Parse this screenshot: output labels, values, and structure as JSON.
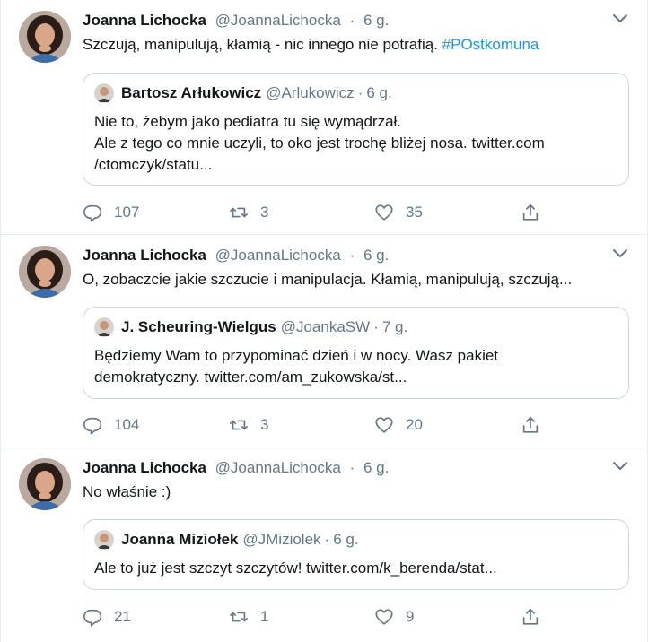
{
  "colors": {
    "text": "#14171a",
    "secondary": "#657786",
    "link": "#1b95e0",
    "border": "#ccd6dd",
    "divider": "#e6ecf0"
  },
  "tweets": [
    {
      "author": {
        "name": "Joanna Lichocka",
        "handle": "@JoannaLichocka",
        "time": "6 g."
      },
      "text": "Szczują, manipulują, kłamią - nic innego nie potrafią. ",
      "hashtag": "#POstkomuna",
      "quote": {
        "name": "Bartosz Arłukowicz",
        "handle": "@Arlukowicz",
        "time": "6 g.",
        "text": "Nie to, żebym jako pediatra tu się wymądrzał.\nAle z tego co mnie uczyli, to oko jest trochę bliżej nosa. twitter.com\n/ctomczyk/statu..."
      },
      "stats": {
        "replies": "107",
        "retweets": "3",
        "likes": "35"
      }
    },
    {
      "author": {
        "name": "Joanna Lichocka",
        "handle": "@JoannaLichocka",
        "time": "6 g."
      },
      "text": "O, zobaczcie jakie szczucie i manipulacja. Kłamią, manipulują, szczują...",
      "hashtag": "",
      "quote": {
        "name": "J. Scheuring-Wielgus",
        "handle": "@JoankaSW",
        "time": "7 g.",
        "text": "Będziemy Wam to przypominać dzień i w nocy. Wasz pakiet\ndemokratyczny. twitter.com/am_zukowska/st..."
      },
      "stats": {
        "replies": "104",
        "retweets": "3",
        "likes": "20"
      }
    },
    {
      "author": {
        "name": "Joanna Lichocka",
        "handle": "@JoannaLichocka",
        "time": "6 g."
      },
      "text": "No właśnie :)",
      "hashtag": "",
      "quote": {
        "name": "Joanna Miziołek",
        "handle": "@JMiziolek",
        "time": "6 g.",
        "text": "Ale to już jest szczyt szczytów! twitter.com/k_berenda/stat..."
      },
      "stats": {
        "replies": "21",
        "retweets": "1",
        "likes": "9"
      }
    }
  ],
  "icons": {
    "caret": "chevron-down-icon",
    "reply": "reply-icon",
    "retweet": "retweet-icon",
    "like": "heart-icon",
    "share": "share-icon"
  },
  "separator": "·"
}
